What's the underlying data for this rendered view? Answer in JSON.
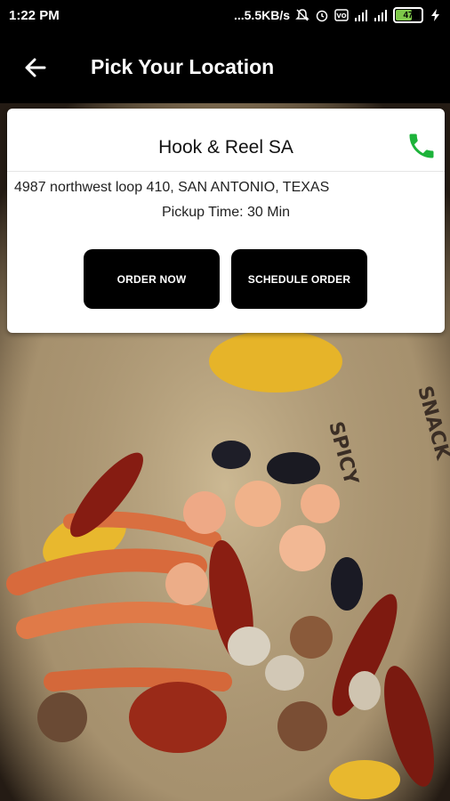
{
  "status_bar": {
    "time": "1:22 PM",
    "network_speed": "...5.5KB/s",
    "battery_level": "47",
    "icons": [
      "mute-icon",
      "alarm-icon",
      "vo-lte-icon",
      "signal-icon",
      "signal-icon",
      "battery-icon",
      "charging-icon"
    ]
  },
  "app_bar": {
    "title": "Pick Your Location",
    "back_icon": "arrow-left-icon"
  },
  "location_card": {
    "restaurant_name": "Hook & Reel SA",
    "address": "4987 northwest loop 410, SAN ANTONIO, TEXAS",
    "pickup_time": "Pickup Time: 30 Min",
    "phone_icon": "phone-icon",
    "phone_icon_color": "#1db33a",
    "buttons": {
      "order_now": "ORDER NOW",
      "schedule_order": "SCHEDULE ORDER"
    }
  },
  "background": {
    "decorative_text": [
      "SPICY",
      "SNACK"
    ]
  }
}
